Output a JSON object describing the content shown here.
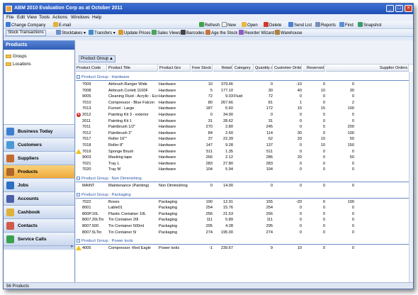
{
  "window": {
    "title": "ABM 2010 Evaluation Corp as at October 2011"
  },
  "menu": [
    "File",
    "Edit",
    "View",
    "Tools",
    "Actions",
    "Windows",
    "Help"
  ],
  "toolbar1": {
    "change_company": "Change Company",
    "email": "E-mail",
    "refresh": "Refresh",
    "new": "New",
    "open": "Open",
    "delete": "Delete",
    "send_list": "Send List",
    "reports": "Reports",
    "find": "Find",
    "snapshot": "Snapshot"
  },
  "toolbar2": {
    "stock_transactions": "Stock Transactions",
    "stocktakes": "Stocktakes",
    "transfers": "Transfers",
    "update_prices": "Update Prices",
    "sales_views": "Sales Views",
    "barcodes": "Barcodes",
    "age_the_stock": "Age the Stock",
    "reorder_wizard": "Reorder Wizard",
    "warehouse": "Warehouse"
  },
  "sidebar": {
    "header": "Products",
    "tree": [
      "Groups",
      "Locations"
    ],
    "nav": [
      "Business Today",
      "Customers",
      "Suppliers",
      "Products",
      "Jobs",
      "Accounts",
      "Cashbook",
      "Contacts",
      "Service Calls"
    ],
    "active": "Products"
  },
  "status": {
    "count": "56 Products"
  },
  "grouping": {
    "chip": "Product Group"
  },
  "columns": [
    "Product Code",
    "Product Title",
    "Product Gro",
    "Free Stock",
    "Retail",
    "Category",
    "Quantity on",
    "Customer Orders",
    "Reserved",
    "Supplier Orders"
  ],
  "groups": [
    {
      "label": "Product Group : Hardware",
      "rows": [
        [
          "7009",
          "Airbrush Ranger Wide",
          "Hardware",
          "10",
          "379.66",
          "",
          "0",
          "-10",
          "0",
          "0",
          ""
        ],
        [
          "7008",
          "Airbrush Corlett 1100F",
          "Hardware",
          "5",
          "177.10",
          "",
          "30",
          "40",
          "10",
          "30",
          ""
        ],
        [
          "9005",
          "Cleaning Fluid - Acrylic - Eco",
          "Hardware",
          "72",
          "9.03",
          "Fluid",
          "72",
          "0",
          "0",
          "0",
          ""
        ],
        [
          "7010",
          "Compressor - Blue Falcon",
          "Hardware",
          "80",
          "267.66",
          "",
          "81",
          "1",
          "0",
          "2",
          ""
        ],
        [
          "7013",
          "Funnel - Large",
          "Hardware",
          "187",
          "5.60",
          "",
          "172",
          "15",
          "15",
          "100",
          ""
        ],
        [
          "2012",
          "Painting Kit 3 - exterior",
          "Hardware",
          "0",
          "34.00",
          "",
          "0",
          "0",
          "0",
          "0",
          "error"
        ],
        [
          "2011",
          "Painting Kit 1",
          "Hardware",
          "31",
          "28.62",
          "",
          "31",
          "0",
          "0",
          "0",
          ""
        ],
        [
          "7011",
          "Paintbrush 1/2\"",
          "Hardware",
          "270",
          "2.80",
          "",
          "245",
          "0",
          "0",
          "200",
          ""
        ],
        [
          "7012",
          "Paintbrush 2\"",
          "Hardware",
          "84",
          "2.60",
          "",
          "114",
          "30",
          "0",
          "100",
          ""
        ],
        [
          "7017",
          "Roller 16\"\"",
          "Hardware",
          "37",
          "22.39",
          "",
          "62",
          "33",
          "10",
          "50",
          ""
        ],
        [
          "7018",
          "Roller 8\"",
          "Hardware",
          "147",
          "9.28",
          "",
          "137",
          "0",
          "10",
          "150",
          ""
        ],
        [
          "7019",
          "Sponge Brush",
          "Hardware",
          "511",
          "1.35",
          "",
          "511",
          "0",
          "0",
          "0",
          "warning"
        ],
        [
          "9003",
          "Masking tape",
          "Hardware",
          "266",
          "2.12",
          "",
          "286",
          "20",
          "0",
          "50",
          ""
        ],
        [
          "7021",
          "Tray L",
          "Hardware",
          "283",
          "27.80",
          "",
          "283",
          "0",
          "0",
          "0",
          ""
        ],
        [
          "7020",
          "Tray M",
          "Hardware",
          "104",
          "5.94",
          "",
          "104",
          "0",
          "0",
          "0",
          ""
        ]
      ]
    },
    {
      "label": "Product Group : Non Diminishing",
      "rows": [
        [
          "MAINT",
          "Maintenance (Painting)",
          "Non Diminishing",
          "0",
          "14.00",
          "",
          "0",
          "0",
          "0",
          "0",
          ""
        ]
      ]
    },
    {
      "label": "Product Group : Packaging",
      "rows": [
        [
          "7022",
          "Boxes",
          "Packaging",
          "190",
          "12.91",
          "",
          "155",
          "-20",
          "0",
          "100",
          ""
        ],
        [
          "8001",
          "Lable01",
          "Packaging",
          "254",
          "15.76",
          "",
          "254",
          "0",
          "0",
          "0",
          ""
        ],
        [
          "800P.10L",
          "Plastic Container 10L",
          "Packaging",
          "256",
          "21.53",
          "",
          "256",
          "0",
          "0",
          "0",
          ""
        ],
        [
          "8007.20LTin",
          "Tin Container 20l",
          "Packaging",
          "111",
          "5.89",
          "",
          "111",
          "0",
          "0",
          "0",
          ""
        ],
        [
          "8007.500",
          "Tin Container 500ml",
          "Packaging",
          "295",
          "4.28",
          "",
          "295",
          "0",
          "0",
          "0",
          ""
        ],
        [
          "8007.5LTin",
          "Tin Container 5l",
          "Packaging",
          "274",
          "195.00",
          "",
          "274",
          "0",
          "0",
          "0",
          ""
        ]
      ]
    },
    {
      "label": "Product Group : Power tools",
      "rows": [
        [
          "4005",
          "Compressor -Red Eagle",
          "Power tools",
          "-1",
          "239.67",
          "",
          "9",
          "10",
          "0",
          "0",
          "warning"
        ]
      ]
    }
  ]
}
